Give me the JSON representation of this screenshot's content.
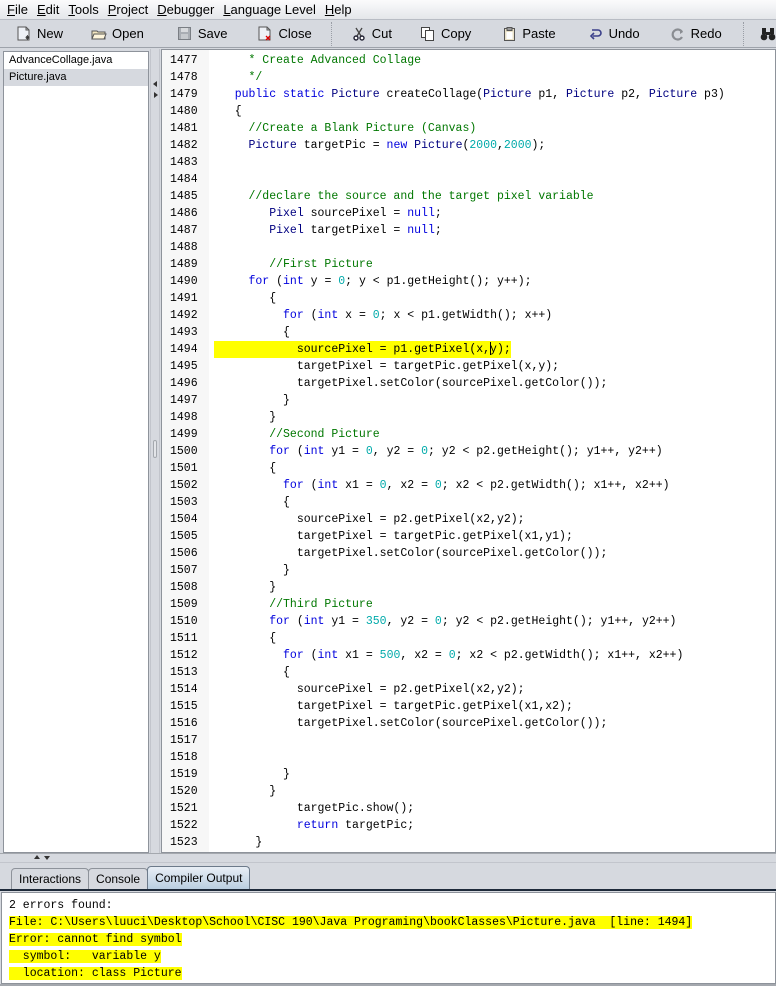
{
  "menu": [
    {
      "mnemonic": "F",
      "rest": "ile"
    },
    {
      "mnemonic": "E",
      "rest": "dit"
    },
    {
      "mnemonic": "T",
      "rest": "ools"
    },
    {
      "mnemonic": "P",
      "rest": "roject"
    },
    {
      "mnemonic": "D",
      "rest": "ebugger"
    },
    {
      "mnemonic": "L",
      "rest": "anguage Level"
    },
    {
      "mnemonic": "H",
      "rest": "elp"
    }
  ],
  "toolbar": {
    "new": "New",
    "open": "Open",
    "save": "Save",
    "close": "Close",
    "cut": "Cut",
    "copy": "Copy",
    "paste": "Paste",
    "undo": "Undo",
    "redo": "Redo",
    "find": "Find"
  },
  "files": [
    {
      "name": "AdvanceCollage.java",
      "selected": false
    },
    {
      "name": "Picture.java",
      "selected": true
    }
  ],
  "editor": {
    "highlight_color": "#ffff00",
    "highlighted_line": 1494,
    "lines": [
      {
        "n": "1477",
        "tokens": [
          [
            "cm",
            "     * Create Advanced Collage"
          ]
        ]
      },
      {
        "n": "1478",
        "tokens": [
          [
            "cm",
            "     */"
          ]
        ]
      },
      {
        "n": "1479",
        "tokens": [
          [
            "kw",
            "   public static "
          ],
          [
            "ty",
            "Picture"
          ],
          [
            "",
            " createCollage("
          ],
          [
            "ty",
            "Picture"
          ],
          [
            "",
            " p1, "
          ],
          [
            "ty",
            "Picture"
          ],
          [
            "",
            " p2, "
          ],
          [
            "ty",
            "Picture"
          ],
          [
            "",
            " p3)"
          ]
        ]
      },
      {
        "n": "1480",
        "tokens": [
          [
            "",
            "   {"
          ]
        ]
      },
      {
        "n": "1481",
        "tokens": [
          [
            "cm",
            "     //Create a Blank Picture (Canvas)"
          ]
        ]
      },
      {
        "n": "1482",
        "tokens": [
          [
            "ty",
            "     Picture"
          ],
          [
            "",
            " targetPic = "
          ],
          [
            "kw",
            "new"
          ],
          [
            "ty",
            " Picture"
          ],
          [
            "",
            "("
          ],
          [
            "nu",
            "2000"
          ],
          [
            "",
            ","
          ],
          [
            "nu",
            "2000"
          ],
          [
            "",
            ");"
          ]
        ]
      },
      {
        "n": "1483",
        "tokens": []
      },
      {
        "n": "1484",
        "tokens": []
      },
      {
        "n": "1485",
        "tokens": [
          [
            "cm",
            "     //declare the source and the target pixel variable"
          ]
        ]
      },
      {
        "n": "1486",
        "tokens": [
          [
            "ty",
            "        Pixel"
          ],
          [
            "",
            " sourcePixel = "
          ],
          [
            "kw",
            "null"
          ],
          [
            "",
            ";"
          ]
        ]
      },
      {
        "n": "1487",
        "tokens": [
          [
            "ty",
            "        Pixel"
          ],
          [
            "",
            " targetPixel = "
          ],
          [
            "kw",
            "null"
          ],
          [
            "",
            ";"
          ]
        ]
      },
      {
        "n": "1488",
        "tokens": []
      },
      {
        "n": "1489",
        "tokens": [
          [
            "cm",
            "        //First Picture"
          ]
        ]
      },
      {
        "n": "1490",
        "tokens": [
          [
            "kw",
            "     for"
          ],
          [
            "",
            " ("
          ],
          [
            "kw",
            "int"
          ],
          [
            "",
            " y = "
          ],
          [
            "nu",
            "0"
          ],
          [
            "",
            "; y < p1.getHeight(); y++);"
          ]
        ]
      },
      {
        "n": "1491",
        "tokens": [
          [
            "",
            "        {"
          ]
        ]
      },
      {
        "n": "1492",
        "tokens": [
          [
            "kw",
            "          for"
          ],
          [
            "",
            " ("
          ],
          [
            "kw",
            "int"
          ],
          [
            "",
            " x = "
          ],
          [
            "nu",
            "0"
          ],
          [
            "",
            "; x < p1.getWidth(); x++)"
          ]
        ]
      },
      {
        "n": "1493",
        "tokens": [
          [
            "",
            "          {"
          ]
        ]
      },
      {
        "n": "1494",
        "tokens": [
          [
            "",
            "            sourcePixel = p1.getPixel(x,"
          ],
          [
            "caret",
            ""
          ],
          [
            "",
            "y);"
          ]
        ]
      },
      {
        "n": "1495",
        "tokens": [
          [
            "",
            "            targetPixel = targetPic.getPixel(x,y);"
          ]
        ]
      },
      {
        "n": "1496",
        "tokens": [
          [
            "",
            "            targetPixel.setColor(sourcePixel.getColor());"
          ]
        ]
      },
      {
        "n": "1497",
        "tokens": [
          [
            "",
            "          }"
          ]
        ]
      },
      {
        "n": "1498",
        "tokens": [
          [
            "",
            "        }"
          ]
        ]
      },
      {
        "n": "1499",
        "tokens": [
          [
            "cm",
            "        //Second Picture"
          ]
        ]
      },
      {
        "n": "1500",
        "tokens": [
          [
            "kw",
            "        for"
          ],
          [
            "",
            " ("
          ],
          [
            "kw",
            "int"
          ],
          [
            "",
            " y1 = "
          ],
          [
            "nu",
            "0"
          ],
          [
            "",
            ", y2 = "
          ],
          [
            "nu",
            "0"
          ],
          [
            "",
            "; y2 < p2.getHeight(); y1++, y2++)"
          ]
        ]
      },
      {
        "n": "1501",
        "tokens": [
          [
            "",
            "        {"
          ]
        ]
      },
      {
        "n": "1502",
        "tokens": [
          [
            "kw",
            "          for"
          ],
          [
            "",
            " ("
          ],
          [
            "kw",
            "int"
          ],
          [
            "",
            " x1 = "
          ],
          [
            "nu",
            "0"
          ],
          [
            "",
            ", x2 = "
          ],
          [
            "nu",
            "0"
          ],
          [
            "",
            "; x2 < p2.getWidth(); x1++, x2++)"
          ]
        ]
      },
      {
        "n": "1503",
        "tokens": [
          [
            "",
            "          {"
          ]
        ]
      },
      {
        "n": "1504",
        "tokens": [
          [
            "",
            "            sourcePixel = p2.getPixel(x2,y2);"
          ]
        ]
      },
      {
        "n": "1505",
        "tokens": [
          [
            "",
            "            targetPixel = targetPic.getPixel(x1,y1);"
          ]
        ]
      },
      {
        "n": "1506",
        "tokens": [
          [
            "",
            "            targetPixel.setColor(sourcePixel.getColor());"
          ]
        ]
      },
      {
        "n": "1507",
        "tokens": [
          [
            "",
            "          }"
          ]
        ]
      },
      {
        "n": "1508",
        "tokens": [
          [
            "",
            "        }"
          ]
        ]
      },
      {
        "n": "1509",
        "tokens": [
          [
            "cm",
            "        //Third Picture"
          ]
        ]
      },
      {
        "n": "1510",
        "tokens": [
          [
            "kw",
            "        for"
          ],
          [
            "",
            " ("
          ],
          [
            "kw",
            "int"
          ],
          [
            "",
            " y1 = "
          ],
          [
            "nu",
            "350"
          ],
          [
            "",
            ", y2 = "
          ],
          [
            "nu",
            "0"
          ],
          [
            "",
            "; y2 < p2.getHeight(); y1++, y2++)"
          ]
        ]
      },
      {
        "n": "1511",
        "tokens": [
          [
            "",
            "        {"
          ]
        ]
      },
      {
        "n": "1512",
        "tokens": [
          [
            "kw",
            "          for"
          ],
          [
            "",
            " ("
          ],
          [
            "kw",
            "int"
          ],
          [
            "",
            " x1 = "
          ],
          [
            "nu",
            "500"
          ],
          [
            "",
            ", x2 = "
          ],
          [
            "nu",
            "0"
          ],
          [
            "",
            "; x2 < p2.getWidth(); x1++, x2++)"
          ]
        ]
      },
      {
        "n": "1513",
        "tokens": [
          [
            "",
            "          {"
          ]
        ]
      },
      {
        "n": "1514",
        "tokens": [
          [
            "",
            "            sourcePixel = p2.getPixel(x2,y2);"
          ]
        ]
      },
      {
        "n": "1515",
        "tokens": [
          [
            "",
            "            targetPixel = targetPic.getPixel(x1,x2);"
          ]
        ]
      },
      {
        "n": "1516",
        "tokens": [
          [
            "",
            "            targetPixel.setColor(sourcePixel.getColor());"
          ]
        ]
      },
      {
        "n": "1517",
        "tokens": []
      },
      {
        "n": "1518",
        "tokens": []
      },
      {
        "n": "1519",
        "tokens": [
          [
            "",
            "          }"
          ]
        ]
      },
      {
        "n": "1520",
        "tokens": [
          [
            "",
            "        }"
          ]
        ]
      },
      {
        "n": "1521",
        "tokens": [
          [
            "",
            "            targetPic.show();"
          ]
        ]
      },
      {
        "n": "1522",
        "tokens": [
          [
            "kw",
            "            return"
          ],
          [
            "",
            " targetPic;"
          ]
        ]
      },
      {
        "n": "1523",
        "tokens": [
          [
            "",
            "      }"
          ]
        ]
      }
    ]
  },
  "tabs": [
    {
      "label": "Interactions",
      "active": false
    },
    {
      "label": "Console",
      "active": false
    },
    {
      "label": "Compiler Output",
      "active": true
    }
  ],
  "output": {
    "summary": "2 errors found:",
    "file_line": "File: C:\\Users\\luuci\\Desktop\\School\\CISC 190\\Java Programing\\bookClasses\\Picture.java  [line: 1494]",
    "error_line": "Error: cannot find symbol",
    "symbol_line": "  symbol:   variable y",
    "location_line": "  location: class Picture"
  }
}
